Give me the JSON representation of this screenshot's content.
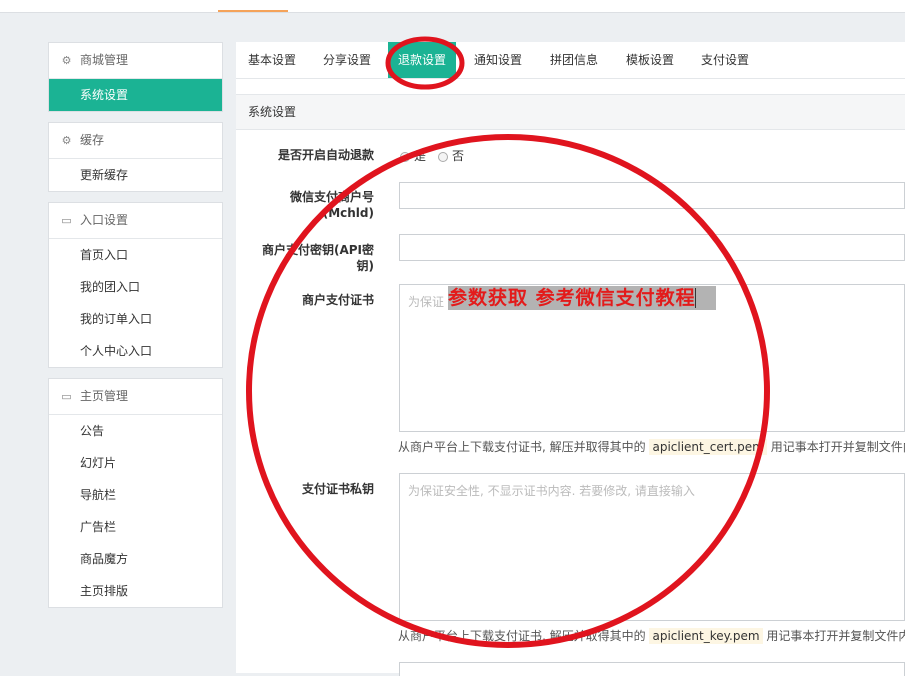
{
  "sidebar": {
    "groups": [
      {
        "header": "商城管理",
        "items": [
          "系统设置"
        ]
      },
      {
        "header": "缓存",
        "items": [
          "更新缓存"
        ]
      },
      {
        "header": "入口设置",
        "items": [
          "首页入口",
          "我的团入口",
          "我的订单入口",
          "个人中心入口"
        ]
      },
      {
        "header": "主页管理",
        "items": [
          "公告",
          "幻灯片",
          "导航栏",
          "广告栏",
          "商品魔方",
          "主页排版"
        ]
      }
    ]
  },
  "tabs": [
    "基本设置",
    "分享设置",
    "退款设置",
    "通知设置",
    "拼团信息",
    "模板设置",
    "支付设置"
  ],
  "panel": {
    "title": "系统设置",
    "auto_refund": {
      "label": "是否开启自动退款",
      "yes": "是",
      "no": "否"
    },
    "mchid": {
      "label_line1": "微信支付商户号",
      "label_line2": "(Mchld)"
    },
    "api_key": {
      "label_line1": "商户支付密钥(API密",
      "label_line2": "钥)"
    },
    "cert": {
      "label": "商户支付证书",
      "placeholder": "为保证",
      "help_prefix": "从商户平台上下载支付证书, 解压并取得其中的",
      "help_file": "apiclient_cert.pem",
      "help_suffix": "用记事本打开并复制文件内容"
    },
    "key": {
      "label": "支付证书私钥",
      "placeholder": "为保证安全性, 不显示证书内容. 若要修改, 请直接输入",
      "help_prefix": "从商户平台上下载支付证书, 解压并取得其中的",
      "help_file": "apiclient_key.pem",
      "help_suffix": "用记事本打开并复制文件内容"
    }
  },
  "annotation": {
    "text": "参数获取 参考微信支付教程",
    "color": "#e31b1b"
  },
  "colors": {
    "accent": "#1bb394",
    "highlight": "#e31b1b"
  }
}
